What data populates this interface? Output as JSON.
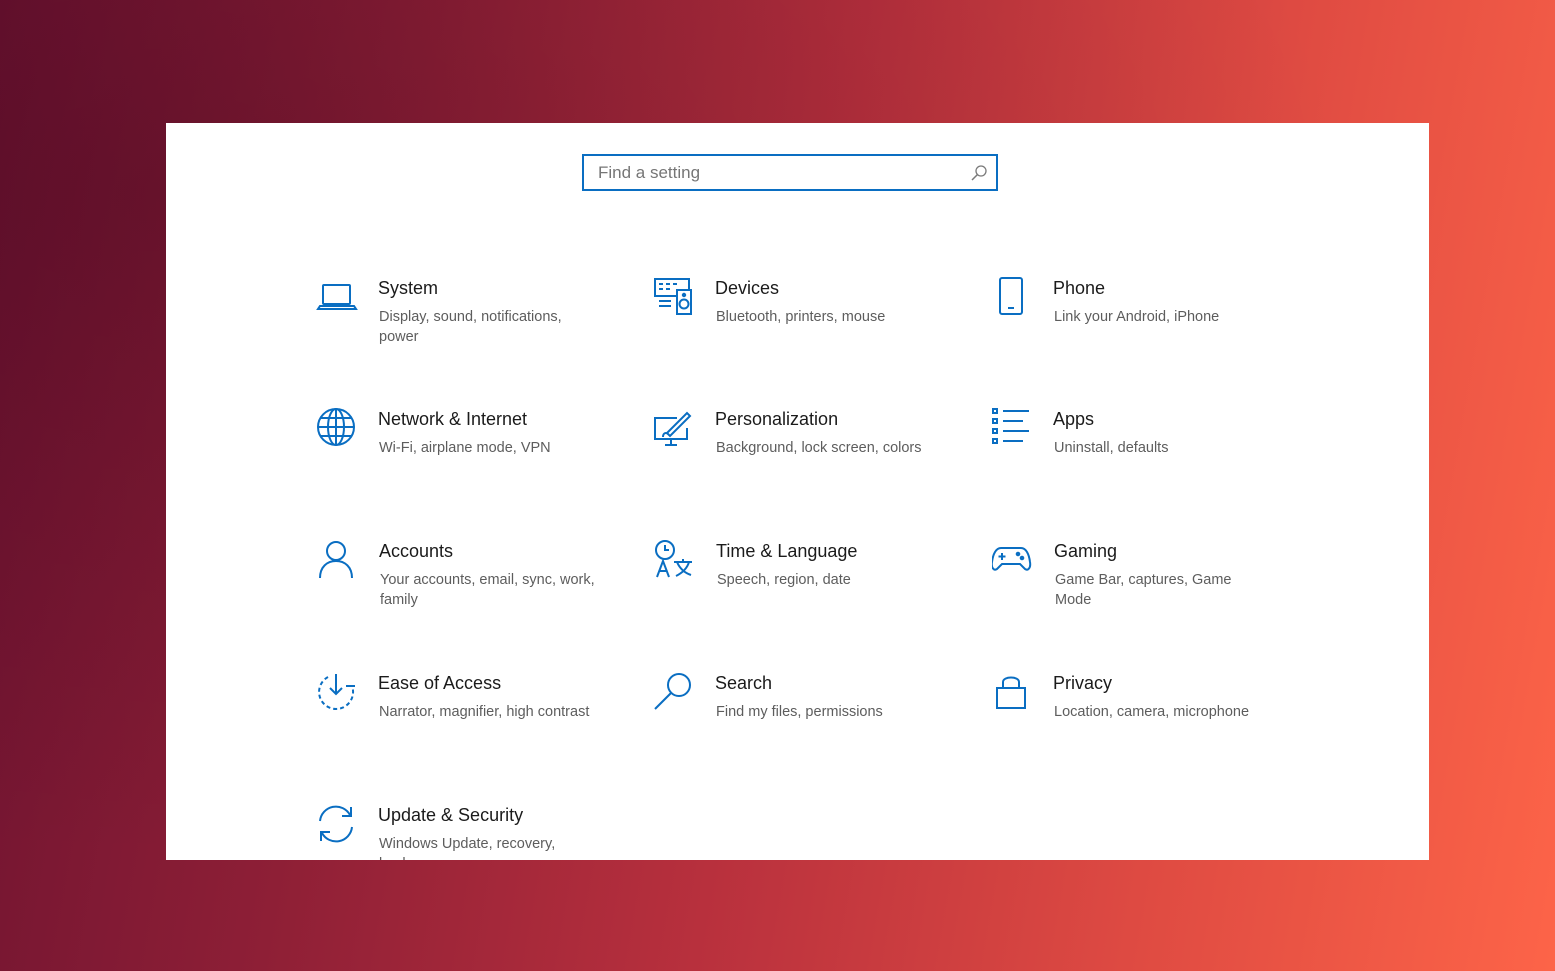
{
  "search": {
    "placeholder": "Find a setting",
    "value": ""
  },
  "tiles": [
    {
      "title": "System",
      "desc": "Display, sound, notifications, power",
      "icon": "laptop-icon"
    },
    {
      "title": "Devices",
      "desc": "Bluetooth, printers, mouse",
      "icon": "devices-icon"
    },
    {
      "title": "Phone",
      "desc": "Link your Android, iPhone",
      "icon": "phone-icon"
    },
    {
      "title": "Network & Internet",
      "desc": "Wi-Fi, airplane mode, VPN",
      "icon": "globe-icon"
    },
    {
      "title": "Personalization",
      "desc": "Background, lock screen, colors",
      "icon": "paint-brush-icon"
    },
    {
      "title": "Apps",
      "desc": "Uninstall, defaults",
      "icon": "apps-list-icon"
    },
    {
      "title": "Accounts",
      "desc": "Your accounts, email, sync, work, family",
      "icon": "person-icon"
    },
    {
      "title": "Time & Language",
      "desc": "Speech, region, date",
      "icon": "time-language-icon"
    },
    {
      "title": "Gaming",
      "desc": "Game Bar, captures, Game Mode",
      "icon": "gamepad-icon"
    },
    {
      "title": "Ease of Access",
      "desc": "Narrator, magnifier, high contrast",
      "icon": "ease-of-access-icon"
    },
    {
      "title": "Search",
      "desc": "Find my files, permissions",
      "icon": "magnifier-icon"
    },
    {
      "title": "Privacy",
      "desc": "Location, camera, microphone",
      "icon": "lock-icon"
    },
    {
      "title": "Update & Security",
      "desc": "Windows Update, recovery, backup",
      "icon": "sync-arrows-icon"
    }
  ],
  "colors": {
    "accent": "#0a6ec2",
    "window_bg": "#ffffff",
    "title_text": "#1b1b1b",
    "desc_text": "#5d5d5d"
  }
}
